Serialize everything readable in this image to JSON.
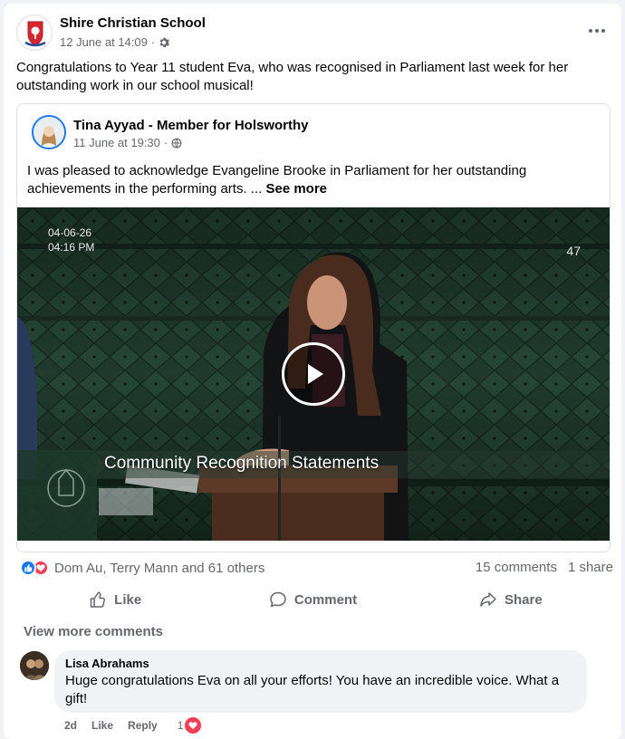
{
  "post": {
    "author": "Shire Christian School",
    "timestamp": "12 June at 14:09",
    "audience_icon": "gear-icon",
    "text": "Congratulations to Year 11 student Eva, who was recognised in Parliament last week for her outstanding work in our school musical!"
  },
  "shared": {
    "author": "Tina Ayyad - Member for Holsworthy",
    "timestamp": "11 June at 19:30",
    "audience_icon": "globe-icon",
    "text": "I was pleased to acknowledge Evangeline Brooke in Parliament for her outstanding achievements in the performing arts. ...",
    "see_more": "See more"
  },
  "video": {
    "date": "04-06-26",
    "time": "04:16 PM",
    "channel": "47",
    "caption": "Community Recognition Statements"
  },
  "stats": {
    "reactors": "Dom Au, Terry Mann and 61 others",
    "comments": "15 comments",
    "shares": "1 share"
  },
  "actions": {
    "like": "Like",
    "comment": "Comment",
    "share": "Share"
  },
  "view_more_comments": "View more comments",
  "comment": {
    "author": "Lisa Abrahams",
    "text": "Huge congratulations Eva on all your efforts! You have an incredible voice. What a gift!",
    "age": "2d",
    "like": "Like",
    "reply": "Reply",
    "reaction_count": "1"
  },
  "colors": {
    "facebook_blue": "#1877f2",
    "love_red": "#f33e58",
    "secondary_text": "#65676b",
    "bench_green": "#1f3a2c"
  }
}
